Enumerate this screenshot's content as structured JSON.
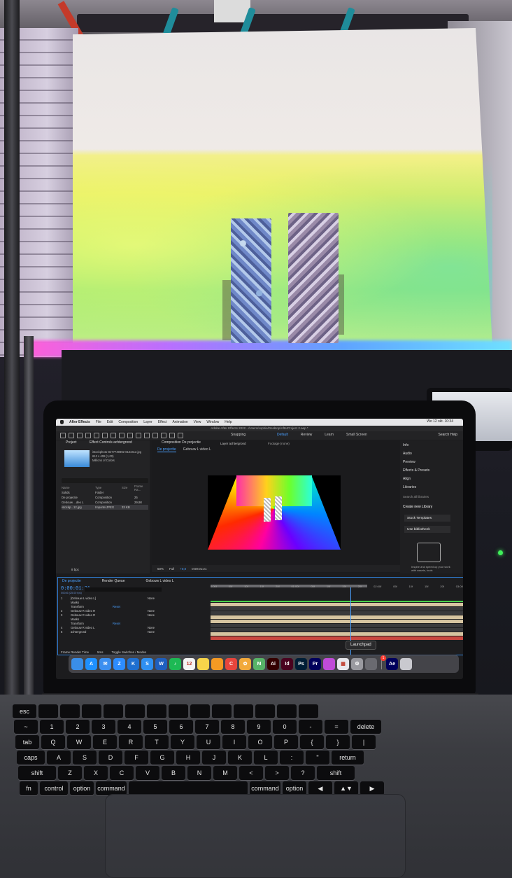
{
  "menubar": {
    "app": "After Effects",
    "items": [
      "File",
      "Edit",
      "Composition",
      "Layer",
      "Effect",
      "Animation",
      "View",
      "Window",
      "Help"
    ],
    "clock": "Wo 12 okt.  10:34"
  },
  "window_title": "Adobe After Effects 2022 - /Users/sophie/Desktop/AfterProject 2.aep *",
  "toolbar": {
    "snapping": "Snapping",
    "workspaces": [
      "Default",
      "Review",
      "Learn",
      "Small Screen"
    ],
    "search_help": "Search Help"
  },
  "project_panel": {
    "tab": "Project",
    "effect_tab": "Effect Controls achtergrond",
    "file_name": "istockphoto-8477749892-612x612.jpg",
    "file_info": "612 x 408 (1,00)",
    "color_info": "Millions of Colors",
    "columns": [
      "Name",
      "Type",
      "Size",
      "Frame Ra..."
    ],
    "rows": [
      {
        "name": "Solids",
        "type": "Folder",
        "size": "",
        "fps": ""
      },
      {
        "name": "De projectie",
        "type": "Composition",
        "size": "",
        "fps": "25"
      },
      {
        "name": "Gebouw ...deo L",
        "type": "Composition",
        "size": "",
        "fps": "29,98"
      },
      {
        "name": "istockp...12.jpg",
        "type": "ImporterJPEG",
        "size": "33 KB",
        "fps": ""
      }
    ],
    "bpc": "8 bpc"
  },
  "comp_panel": {
    "tab": "Composition De projectie",
    "layer_tab": "Layer achtergrond",
    "footage_tab": "Footage (none)",
    "subtabs": [
      "De projectie",
      "Gebouw L video L"
    ],
    "zoom": "50%",
    "resolution": "Full",
    "timecode": "0:00:01:21",
    "plus": "+0,0"
  },
  "right_panel": {
    "items": [
      "Info",
      "Audio",
      "Preview",
      "Effects & Presets",
      "Align",
      "Libraries"
    ],
    "search_placeholder": "Search all libraries",
    "create": "Create new Library",
    "buttons": [
      "Stock Templates",
      "Use bibliotheek"
    ],
    "inspire": "Inspire and speed up your work with assets, tools"
  },
  "timeline": {
    "tabs": [
      "De projectie",
      "Render Queue",
      "Gebouw L video L"
    ],
    "timecode": "0:00:01:21",
    "fps_note": "00046 (25.00 fps)",
    "ruler": [
      "0:00f",
      "05f",
      "10f",
      "15f",
      "20f",
      "01:00f",
      "05f",
      "10f",
      "15f",
      "20f",
      "02:00f",
      "05f",
      "10f",
      "15f",
      "20f",
      "03:00f"
    ],
    "layers": [
      {
        "num": "1",
        "name": "[Gebouw L video L]",
        "switch": "",
        "parent": "None"
      },
      {
        "num": "",
        "name": "Masks",
        "switch": "",
        "parent": ""
      },
      {
        "num": "",
        "name": "Transform",
        "switch": "Reset",
        "parent": ""
      },
      {
        "num": "2",
        "name": "Gebouw R video R",
        "switch": "",
        "parent": "None"
      },
      {
        "num": "3",
        "name": "Gebouw R video R",
        "switch": "",
        "parent": "None"
      },
      {
        "num": "",
        "name": "Masks",
        "switch": "",
        "parent": ""
      },
      {
        "num": "",
        "name": "Transform",
        "switch": "Reset",
        "parent": ""
      },
      {
        "num": "4",
        "name": "Gebouw R video L",
        "switch": "",
        "parent": "None"
      },
      {
        "num": "5",
        "name": "achtergrond",
        "switch": "",
        "parent": "None"
      }
    ],
    "bottom": [
      "Frame Render Time",
      "5ms",
      "Toggle Switches / Modes"
    ],
    "tooltip": "Launchpad"
  },
  "dock": {
    "apps": [
      {
        "name": "finder",
        "label": "",
        "color": "#3a8ee8"
      },
      {
        "name": "app-store",
        "label": "A",
        "color": "#1e90ff"
      },
      {
        "name": "mail",
        "label": "✉",
        "color": "#3b8ff0"
      },
      {
        "name": "zoom",
        "label": "Z",
        "color": "#2d8cff"
      },
      {
        "name": "keynote",
        "label": "K",
        "color": "#1f6fd0"
      },
      {
        "name": "safari",
        "label": "S",
        "color": "#2f90f2"
      },
      {
        "name": "word",
        "label": "W",
        "color": "#1e5fbf"
      },
      {
        "name": "spotify",
        "label": "♪",
        "color": "#1db954"
      },
      {
        "name": "calendar",
        "label": "12",
        "color": "#f4f4f4"
      },
      {
        "name": "notes",
        "label": "",
        "color": "#f7d54a"
      },
      {
        "name": "pages",
        "label": "",
        "color": "#f59a23"
      },
      {
        "name": "chrome",
        "label": "C",
        "color": "#e8453c"
      },
      {
        "name": "photos",
        "label": "✿",
        "color": "#f2a93b"
      },
      {
        "name": "maps",
        "label": "M",
        "color": "#58b368"
      },
      {
        "name": "illustrator",
        "label": "Ai",
        "color": "#330000"
      },
      {
        "name": "indesign",
        "label": "Id",
        "color": "#49021f"
      },
      {
        "name": "photoshop",
        "label": "Ps",
        "color": "#001e36"
      },
      {
        "name": "premiere",
        "label": "Pr",
        "color": "#00005b"
      },
      {
        "name": "siri",
        "label": "",
        "color": "#c04bd8"
      },
      {
        "name": "launchpad",
        "label": "▦",
        "color": "#e8e8ee"
      },
      {
        "name": "system-preferences",
        "label": "⚙",
        "color": "#9a9aa0"
      },
      {
        "name": "disk-utility",
        "label": "",
        "color": "#6a6a70"
      }
    ],
    "after_sep": [
      {
        "name": "after-effects",
        "label": "Ae",
        "color": "#00005b"
      },
      {
        "name": "trash",
        "label": "",
        "color": "#c9c9cf"
      }
    ],
    "badge": "1"
  },
  "keyboard": {
    "rows": [
      [
        "esc",
        "",
        "",
        "",
        "",
        "",
        "",
        "",
        "",
        "",
        "",
        "",
        "",
        ""
      ],
      [
        "~",
        "1",
        "2",
        "3",
        "4",
        "5",
        "6",
        "7",
        "8",
        "9",
        "0",
        "-",
        "=",
        "delete"
      ],
      [
        "tab",
        "Q",
        "W",
        "E",
        "R",
        "T",
        "Y",
        "U",
        "I",
        "O",
        "P",
        "{",
        "}",
        "|"
      ],
      [
        "caps",
        "A",
        "S",
        "D",
        "F",
        "G",
        "H",
        "J",
        "K",
        "L",
        ":",
        "\"",
        "return"
      ],
      [
        "shift",
        "Z",
        "X",
        "C",
        "V",
        "B",
        "N",
        "M",
        "<",
        ">",
        "?",
        "shift"
      ],
      [
        "fn",
        "control",
        "option",
        "command",
        "",
        "command",
        "option",
        "◀",
        "▲▼",
        "▶"
      ]
    ]
  }
}
